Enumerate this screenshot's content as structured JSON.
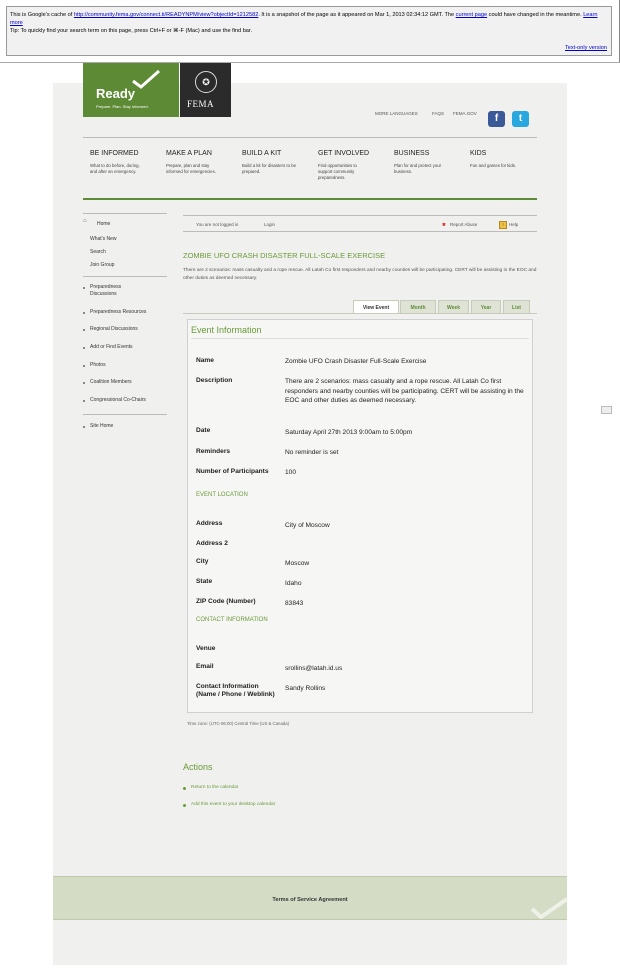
{
  "cache": {
    "line1_pre": "This is Google's cache of ",
    "url": "http://community.fema.gov/connect.ti/READYNPM/view?objectId=1212582",
    "line1_mid": ". It is a snapshot of the page as it appeared on Mar 1, 2013 02:34:12 GMT. The ",
    "current_page": "current page",
    "line1_post": " could have changed in the meantime. ",
    "learn_more": "Learn more",
    "tip": "Tip: To quickly find your search term on this page, press Ctrl+F or ⌘-F (Mac) and use the find bar.",
    "text_only": "Text-only version"
  },
  "logo": {
    "ready": "Ready",
    "tagline": "Prepare. Plan. Stay Informed.",
    "fema": "FEMA"
  },
  "toplinks": [
    "MORE LANGUAGES",
    "FAQS",
    "FEMA.GOV"
  ],
  "social": {
    "facebook": "f",
    "twitter": "t"
  },
  "nav": [
    {
      "title": "BE INFORMED",
      "desc": "What to do before, during, and after an emergency."
    },
    {
      "title": "MAKE A PLAN",
      "desc": "Prepare, plan and stay informed for emergencies."
    },
    {
      "title": "BUILD A KIT",
      "desc": "Build a kit for disasters to be prepared."
    },
    {
      "title": "GET INVOLVED",
      "desc": "Find opportunities to support community preparedness."
    },
    {
      "title": "BUSINESS",
      "desc": "Plan for and protect your business."
    },
    {
      "title": "KIDS",
      "desc": "Fun and games for kids."
    }
  ],
  "sidebar": {
    "home": "Home",
    "whats_new": "What's New",
    "search": "Search",
    "join_group": "Join Group",
    "items": [
      "Preparedness Discussions",
      "Preparedness Resources",
      "Regional Discussions",
      "Add or Find Events",
      "Photos",
      "Coalition Members",
      "Congressional Co-Chairs"
    ],
    "site_home": "Site Home"
  },
  "bar": {
    "not_logged": "You are not logged in",
    "login": "Login",
    "report": "Report Abuse",
    "help": "Help"
  },
  "event": {
    "title": "ZOMBIE UFO CRASH DISASTER FULL-SCALE EXERCISE",
    "summary": "There are 2 scenarios: mass casualty and a rope rescue. All Latah Co first responders and nearby counties will be participating. CERT will be assisting in the EOC and other duties as deemed necessary."
  },
  "tabs": [
    "View Event",
    "Month",
    "Week",
    "Year",
    "List"
  ],
  "info": {
    "heading": "Event Information",
    "name_label": "Name",
    "name": "Zombie UFO Crash Disaster Full-Scale Exercise",
    "desc_label": "Description",
    "desc": "There are 2 scenarios: mass casualty and a rope rescue. All Latah Co first responders and nearby counties will be participating. CERT will be assisting in the EOC and other duties as deemed necessary.",
    "date_label": "Date",
    "date": "Saturday April 27th 2013 9:00am to 5:00pm",
    "reminders_label": "Reminders",
    "reminders": "No reminder is set",
    "participants_label": "Number of Participants",
    "participants": "100",
    "location_section": "EVENT LOCATION",
    "address_label": "Address",
    "address": "City of Moscow",
    "address2_label": "Address 2",
    "city_label": "City",
    "city": "Moscow",
    "state_label": "State",
    "state": "Idaho",
    "zip_label": "ZIP Code (Number)",
    "zip": "83843",
    "contact_section": "CONTACT INFORMATION",
    "venue_label": "Venue",
    "email_label": "Email",
    "email": "srollins@latah.id.us",
    "contact_label": "Contact Information (Name / Phone / Weblink)",
    "contact": "Sandy Rollins"
  },
  "timezone": "Time zone: (UTC-06:00) Central Time (US & Canada)",
  "actions": {
    "heading": "Actions",
    "return": "Return to the calendar",
    "add": "Add this event to your desktop calendar"
  },
  "footer": {
    "terms": "Terms of Service Agreement"
  },
  "colors": {
    "ready_green": "#5d8a35",
    "accent_green": "#6a9a3a",
    "fema_dark": "#2b2b2b"
  }
}
